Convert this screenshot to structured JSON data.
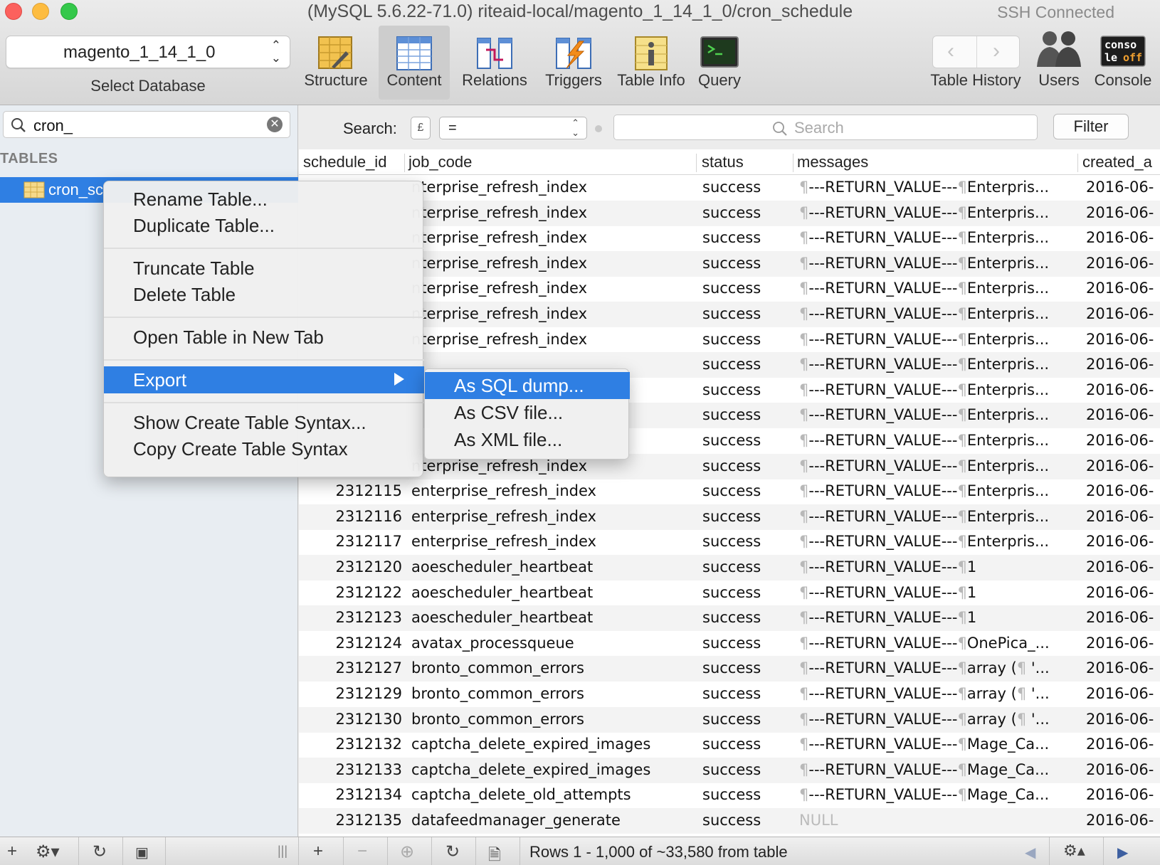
{
  "window": {
    "title": "(MySQL 5.6.22-71.0) riteaid-local/magento_1_14_1_0/cron_schedule",
    "connection": "SSH Connected"
  },
  "toolbar": {
    "database_value": "magento_1_14_1_0",
    "database_caption": "Select Database",
    "buttons": [
      {
        "label": "Structure",
        "icon": "structure-icon"
      },
      {
        "label": "Content",
        "icon": "content-icon",
        "active": true
      },
      {
        "label": "Relations",
        "icon": "relations-icon"
      },
      {
        "label": "Triggers",
        "icon": "triggers-icon"
      },
      {
        "label": "Table Info",
        "icon": "table-info-icon"
      },
      {
        "label": "Query",
        "icon": "query-icon"
      }
    ],
    "right": {
      "history_label": "Table History",
      "users_label": "Users",
      "console_label": "Console",
      "console_icon_text": "conso le off"
    }
  },
  "sidebar": {
    "filter_value": "cron_",
    "section_title": "TABLES",
    "selected_table": "cron_sc"
  },
  "search": {
    "label": "Search:",
    "field_glyph": "£",
    "operator": "=",
    "placeholder": "Search",
    "filter_button": "Filter"
  },
  "grid": {
    "columns": [
      "schedule_id",
      "job_code",
      "status",
      "messages",
      "created_a"
    ],
    "rows": [
      {
        "id": "",
        "job": "nterprise_refresh_index",
        "status": "success",
        "msg_tail": "Enterpris...",
        "created": "2016-06-"
      },
      {
        "id": "",
        "job": "nterprise_refresh_index",
        "status": "success",
        "msg_tail": "Enterpris...",
        "created": "2016-06-"
      },
      {
        "id": "",
        "job": "nterprise_refresh_index",
        "status": "success",
        "msg_tail": "Enterpris...",
        "created": "2016-06-"
      },
      {
        "id": "",
        "job": "nterprise_refresh_index",
        "status": "success",
        "msg_tail": "Enterpris...",
        "created": "2016-06-"
      },
      {
        "id": "",
        "job": "nterprise_refresh_index",
        "status": "success",
        "msg_tail": "Enterpris...",
        "created": "2016-06-"
      },
      {
        "id": "",
        "job": "nterprise_refresh_index",
        "status": "success",
        "msg_tail": "Enterpris...",
        "created": "2016-06-"
      },
      {
        "id": "",
        "job": "nterprise_refresh_index",
        "status": "success",
        "msg_tail": "Enterpris...",
        "created": "2016-06-"
      },
      {
        "id": "",
        "job": "",
        "status": "success",
        "msg_tail": "Enterpris...",
        "created": "2016-06-"
      },
      {
        "id": "",
        "job": "",
        "status": "success",
        "msg_tail": "Enterpris...",
        "created": "2016-06-"
      },
      {
        "id": "",
        "job": "",
        "status": "success",
        "msg_tail": "Enterpris...",
        "created": "2016-06-"
      },
      {
        "id": "",
        "job": "",
        "status": "success",
        "msg_tail": "Enterpris...",
        "created": "2016-06-"
      },
      {
        "id": "",
        "job": "nterprise_refresh_index",
        "status": "success",
        "msg_tail": "Enterpris...",
        "created": "2016-06-"
      },
      {
        "id": "2312115",
        "job": "enterprise_refresh_index",
        "status": "success",
        "msg_tail": "Enterpris...",
        "created": "2016-06-"
      },
      {
        "id": "2312116",
        "job": "enterprise_refresh_index",
        "status": "success",
        "msg_tail": "Enterpris...",
        "created": "2016-06-"
      },
      {
        "id": "2312117",
        "job": "enterprise_refresh_index",
        "status": "success",
        "msg_tail": "Enterpris...",
        "created": "2016-06-"
      },
      {
        "id": "2312120",
        "job": "aoescheduler_heartbeat",
        "status": "success",
        "msg_tail": "1",
        "created": "2016-06-"
      },
      {
        "id": "2312122",
        "job": "aoescheduler_heartbeat",
        "status": "success",
        "msg_tail": "1",
        "created": "2016-06-"
      },
      {
        "id": "2312123",
        "job": "aoescheduler_heartbeat",
        "status": "success",
        "msg_tail": "1",
        "created": "2016-06-"
      },
      {
        "id": "2312124",
        "job": "avatax_processqueue",
        "status": "success",
        "msg_tail": "OnePica_...",
        "created": "2016-06-"
      },
      {
        "id": "2312127",
        "job": "bronto_common_errors",
        "status": "success",
        "msg_tail": "array (¶  '...",
        "created": "2016-06-"
      },
      {
        "id": "2312129",
        "job": "bronto_common_errors",
        "status": "success",
        "msg_tail": "array (¶  '...",
        "created": "2016-06-"
      },
      {
        "id": "2312130",
        "job": "bronto_common_errors",
        "status": "success",
        "msg_tail": "array (¶  '...",
        "created": "2016-06-"
      },
      {
        "id": "2312132",
        "job": "captcha_delete_expired_images",
        "status": "success",
        "msg_tail": "Mage_Ca...",
        "created": "2016-06-"
      },
      {
        "id": "2312133",
        "job": "captcha_delete_expired_images",
        "status": "success",
        "msg_tail": "Mage_Ca...",
        "created": "2016-06-"
      },
      {
        "id": "2312134",
        "job": "captcha_delete_old_attempts",
        "status": "success",
        "msg_tail": "Mage_Ca...",
        "created": "2016-06-"
      },
      {
        "id": "2312135",
        "job": "datafeedmanager_generate",
        "status": "success",
        "msg_tail": "NULL",
        "created": "2016-06-"
      }
    ],
    "msg_prefix": "¶---RETURN_VALUE---¶"
  },
  "bottom": {
    "row_count": "Rows 1 - 1,000 of ~33,580 from table"
  },
  "context_menu": {
    "items": [
      "Rename Table...",
      "Duplicate Table...",
      "Truncate Table",
      "Delete Table",
      "Open Table in New Tab",
      "Export",
      "Show Create Table Syntax...",
      "Copy Create Table Syntax"
    ],
    "export_submenu": [
      "As SQL dump...",
      "As CSV file...",
      "As XML file..."
    ]
  },
  "colors": {
    "selection": "#2f7fe3",
    "sidebar_bg": "#e8edf2",
    "row_alt": "#f3f3f3"
  }
}
